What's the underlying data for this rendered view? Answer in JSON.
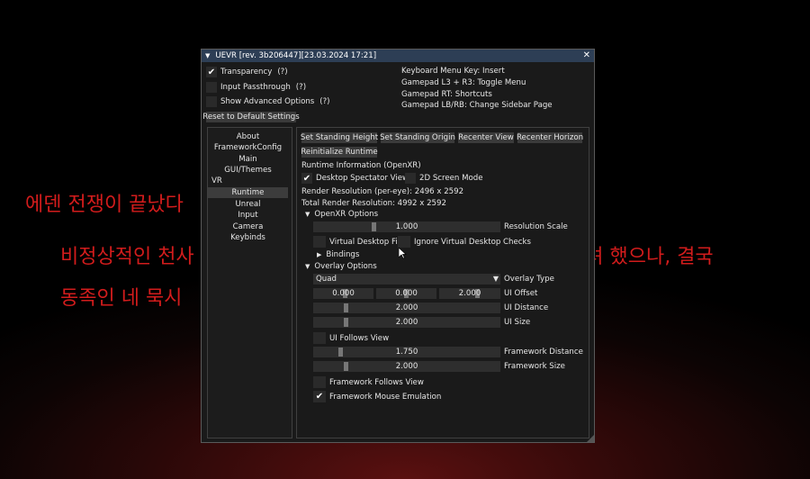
{
  "background_text": {
    "line1": "에덴 전쟁이 끝났다",
    "line2": "비정상적인 천사",
    "line2_right": "하려 했으나, 결국",
    "line3": "동족인 네 묵시"
  },
  "window": {
    "title": "UEVR [rev. 3b206447][23.03.2024 17:21]",
    "close_glyph": "✕",
    "collapse_glyph": "▼"
  },
  "top_options": {
    "transparency": {
      "label": "Transparency",
      "help": "(?)",
      "checked": true
    },
    "input_passthrough": {
      "label": "Input Passthrough",
      "help": "(?)",
      "checked": false
    },
    "show_advanced": {
      "label": "Show Advanced Options",
      "help": "(?)",
      "checked": false
    },
    "reset_button": "Reset to Default Settings"
  },
  "shortcuts": [
    "Keyboard Menu Key: Insert",
    "Gamepad L3 + R3: Toggle Menu",
    "Gamepad RT: Shortcuts",
    "Gamepad LB/RB: Change Sidebar Page"
  ],
  "sidebar": {
    "items": [
      "About",
      "FrameworkConfig",
      "Main",
      "GUI/Themes"
    ],
    "section": "VR",
    "vr_items": [
      "Runtime",
      "Unreal",
      "Input",
      "Camera",
      "Keybinds"
    ],
    "selected": "Runtime"
  },
  "main": {
    "buttons": {
      "set_standing_height": "Set Standing Height",
      "set_standing_origin": "Set Standing Origin",
      "recenter_view": "Recenter View",
      "recenter_horizon": "Recenter Horizon",
      "reinitialize_runtime": "Reinitialize Runtime"
    },
    "runtime_info": "Runtime Information (OpenXR)",
    "desktop_spectator": {
      "label": "Desktop Spectator View",
      "checked": true
    },
    "screen_mode_2d": {
      "label": "2D Screen Mode",
      "checked": false
    },
    "render_resolution": "Render Resolution (per-eye): 2496 x 2592",
    "total_render_resolution": "Total Render Resolution: 4992 x 2592",
    "openxr_options": {
      "header": "OpenXR Options",
      "resolution_scale": {
        "value": "1.000",
        "label": "Resolution Scale",
        "fraction": 0.32
      },
      "virtual_desktop_fix": {
        "label": "Virtual Desktop Fix",
        "checked": false
      },
      "ignore_vd_checks": {
        "label": "Ignore Virtual Desktop Checks",
        "checked": false
      },
      "bindings": "Bindings"
    },
    "overlay_options": {
      "header": "Overlay Options",
      "overlay_type": {
        "value": "Quad",
        "label": "Overlay Type"
      },
      "ui_offset": {
        "values": [
          "0.000",
          "0.000",
          "2.000"
        ],
        "label": "UI Offset"
      },
      "ui_distance": {
        "value": "2.000",
        "label": "UI Distance",
        "fraction": 0.17
      },
      "ui_size": {
        "value": "2.000",
        "label": "UI Size",
        "fraction": 0.17
      },
      "ui_follows_view": {
        "label": "UI Follows View",
        "checked": false
      },
      "framework_distance": {
        "value": "1.750",
        "label": "Framework Distance",
        "fraction": 0.14
      },
      "framework_size": {
        "value": "2.000",
        "label": "Framework Size",
        "fraction": 0.17
      },
      "framework_follows_view": {
        "label": "Framework Follows View",
        "checked": false
      },
      "framework_mouse_emulation": {
        "label": "Framework Mouse Emulation",
        "checked": true
      }
    }
  },
  "colors": {
    "title_bar": "#2d3e55",
    "window_bg": "#1a1a1a",
    "bg_text": "#d21c1c"
  }
}
